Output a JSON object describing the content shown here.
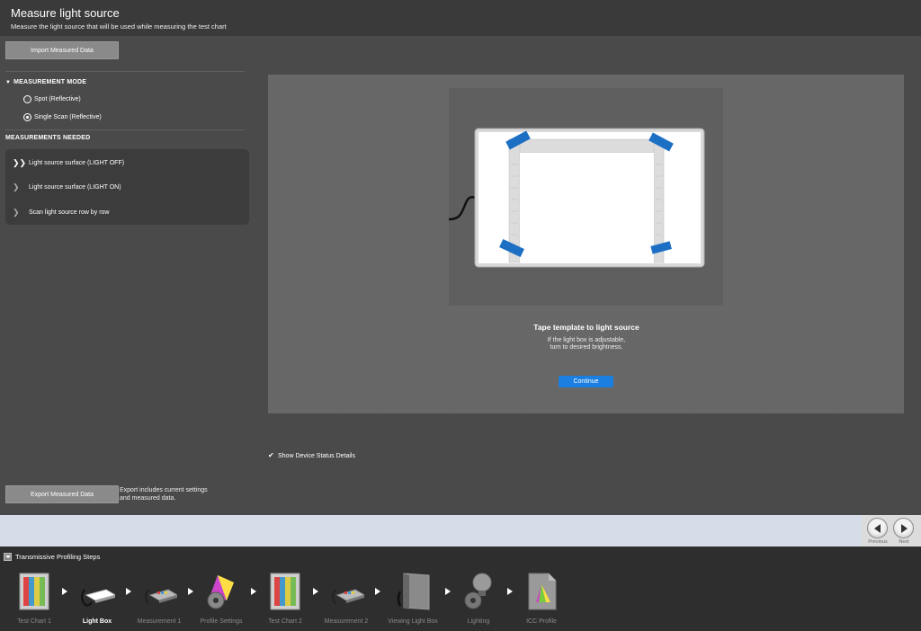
{
  "header": {
    "title": "Measure light source",
    "subtitle": "Measure the light source that will be used while measuring the test chart"
  },
  "left_panel": {
    "import_button": "Import Measured Data",
    "measurement_mode": {
      "heading": "MEASUREMENT MODE",
      "options": [
        {
          "label": "Spot (Reflective)",
          "selected": false
        },
        {
          "label": "Single Scan (Reflective)",
          "selected": true
        }
      ]
    },
    "measurements_needed": {
      "heading": "MEASUREMENTS NEEDED",
      "items": [
        {
          "label": "Light source surface (LIGHT OFF)",
          "active": true
        },
        {
          "label": "Light source surface (LIGHT ON)",
          "active": false
        },
        {
          "label": "Scan light source row by row",
          "active": false
        }
      ]
    },
    "export_button": "Export Measured Data",
    "export_note": "Export includes current settings and measured data."
  },
  "stage": {
    "instruction_title": "Tape template to light source",
    "instruction_body_line1": "If the light box is adjustable,",
    "instruction_body_line2": "turn to desired brightness.",
    "continue_button": "Continue",
    "tape_color": "#1d6fc4"
  },
  "show_device_status": {
    "label": "Show Device Status Details",
    "checked": true
  },
  "navigation": {
    "previous_label": "Previous",
    "next_label": "Next"
  },
  "steps_panel": {
    "title": "Transmissive Profiling Steps",
    "steps": [
      {
        "label": "Test Chart 1",
        "icon": "test-chart-icon",
        "active": false
      },
      {
        "label": "Light Box",
        "icon": "light-box-icon",
        "active": true
      },
      {
        "label": "Measurement 1",
        "icon": "measurement-device-icon",
        "active": false
      },
      {
        "label": "Profile Settings",
        "icon": "profile-settings-icon",
        "active": false
      },
      {
        "label": "Test Chart 2",
        "icon": "test-chart-icon",
        "active": false
      },
      {
        "label": "Measurement 2",
        "icon": "measurement-device-icon",
        "active": false
      },
      {
        "label": "Viewing Light Box",
        "icon": "viewing-light-box-icon",
        "active": false
      },
      {
        "label": "Lighting",
        "icon": "lighting-icon",
        "active": false
      },
      {
        "label": "ICC Profile",
        "icon": "icc-profile-icon",
        "active": false
      }
    ]
  }
}
